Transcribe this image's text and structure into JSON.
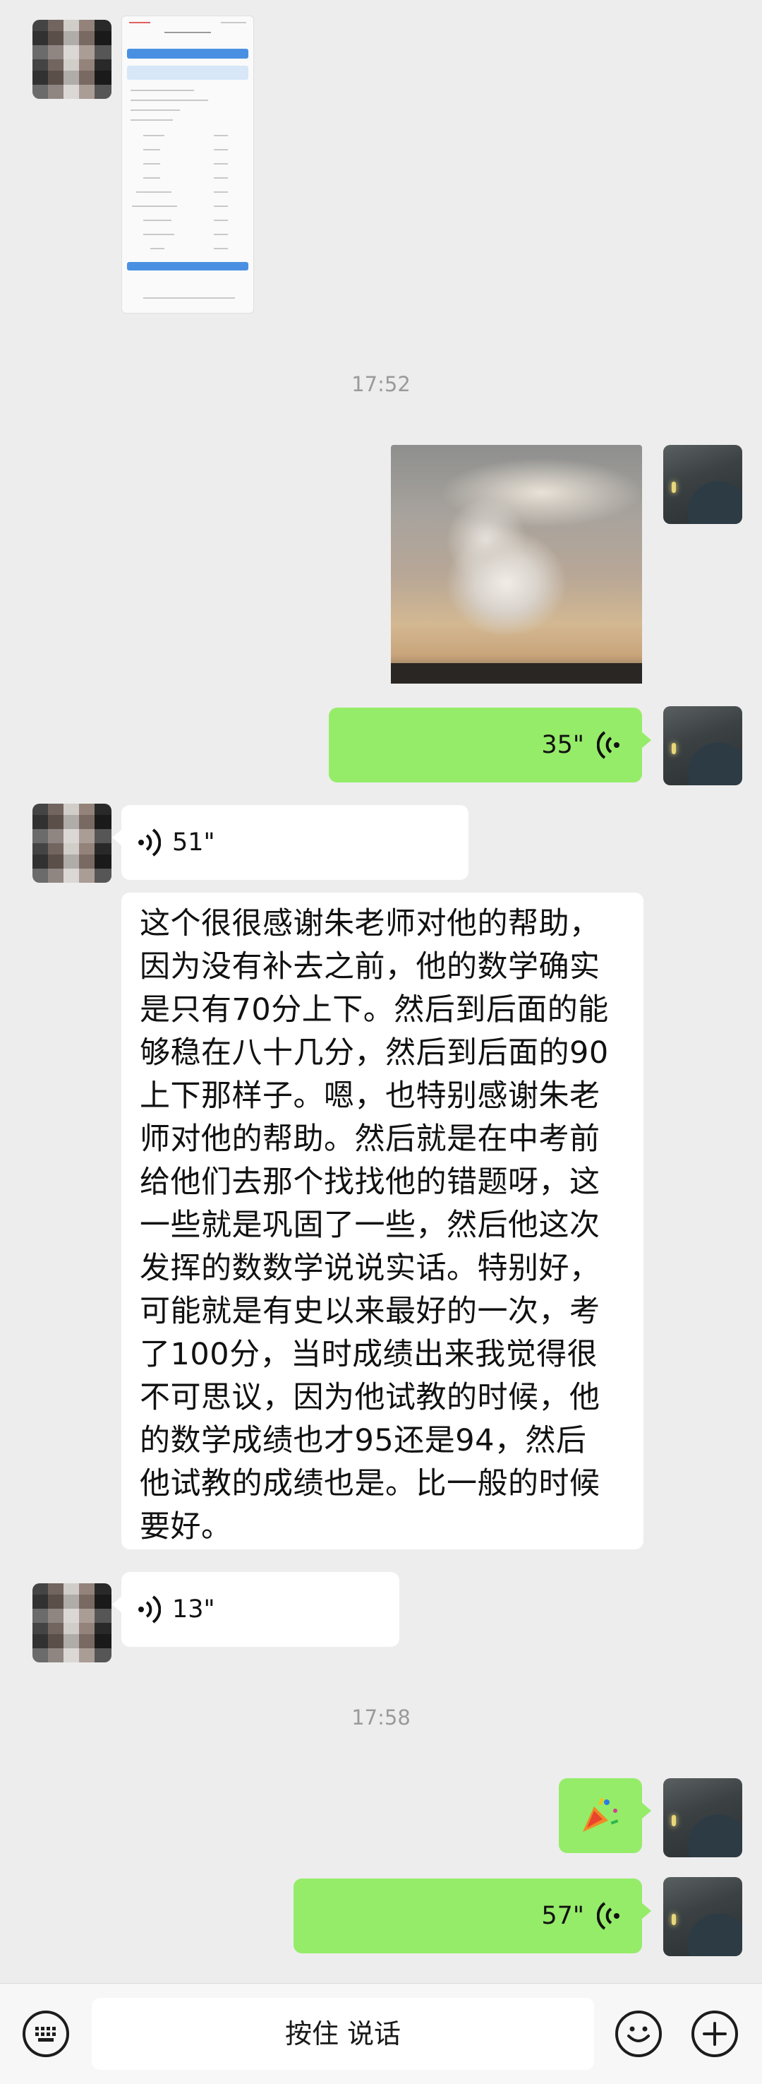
{
  "messages": {
    "time_1": "17:52",
    "time_2": "17:58",
    "voice_out_1": "35\"",
    "voice_in_1": "51\"",
    "voice_in_2": "13\"",
    "voice_out_2": "57\"",
    "long_text": "这个很很感谢朱老师对他的帮助，\n因为没有补去之前，他的数学确实\n是只有70分上下。然后到后面的能\n够稳在八十几分，然后到后面的90\n上下那样子。嗯，也特别感谢朱老\n师对他的帮助。然后就是在中考前\n给他们去那个找找他的错题呀，这\n一些就是巩固了一些，然后他这次\n发挥的数数学说说实话。特别好，\n可能就是有史以来最好的一次，考\n了100分，当时成绩出来我觉得很\n不可思议，因为他试教的时候，他\n的数学成绩也才95还是94，然后\n他试教的成绩也是。比一般的时候\n要好。"
  },
  "input_bar": {
    "hold_to_talk": "按住 说话",
    "keyboard_icon": "keyboard-icon",
    "emoji_icon": "emoji-icon",
    "plus_icon": "plus-icon"
  },
  "colors": {
    "background": "#ededed",
    "sent_bubble": "#95ec69",
    "received_bubble": "#ffffff",
    "timestamp": "#9a9a9a"
  }
}
